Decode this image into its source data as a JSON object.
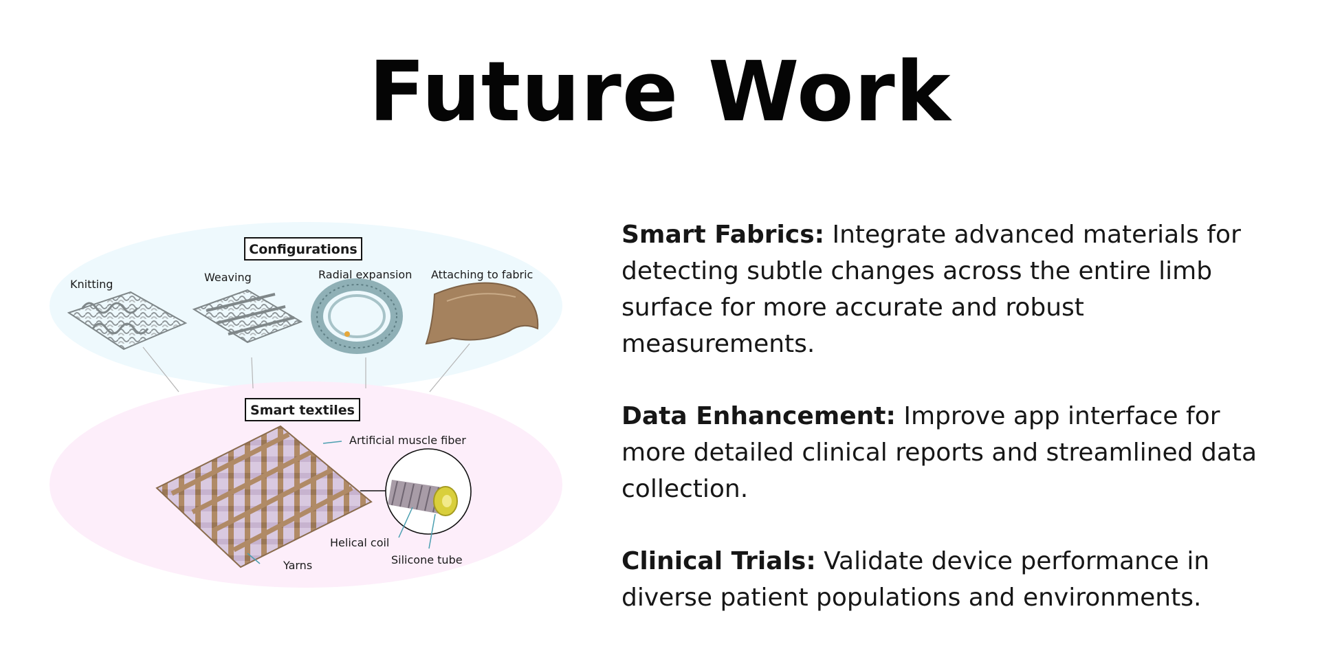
{
  "slide": {
    "title": "Future Work"
  },
  "figure": {
    "configurations_label": "Configurations",
    "smart_textiles_label": "Smart textiles",
    "config_items": [
      "Knitting",
      "Weaving",
      "Radial expansion",
      "Attaching to fabric"
    ],
    "callouts": {
      "artificial_muscle_fiber": "Artificial muscle fiber",
      "helical_coil": "Helical coil",
      "silicone_tube": "Silicone tube",
      "yarns": "Yarns"
    },
    "colors": {
      "top_ellipse": "#eef9fd",
      "bottom_ellipse": "#fdeefa",
      "yarn": "#b08a66",
      "fiber": "#8f9699"
    }
  },
  "bullets": [
    {
      "term": "Smart Fabrics:",
      "text": " Integrate advanced materials for detecting subtle changes across the entire limb surface for more accurate and robust measurements."
    },
    {
      "term": "Data Enhancement:",
      "text": " Improve app interface for more detailed clinical reports and streamlined data collection."
    },
    {
      "term": "Clinical Trials:",
      "text": " Validate device performance in diverse patient populations and environments."
    }
  ]
}
